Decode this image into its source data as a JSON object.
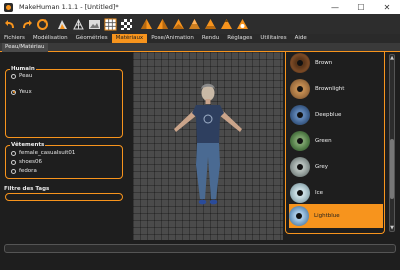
{
  "window": {
    "title": "MakeHuman 1.1.1 - [Untitled]*",
    "minimize": "—",
    "maximize": "☐",
    "close": "✕"
  },
  "toolbar": {
    "icons": [
      "undo-icon",
      "redo-icon",
      "reset-icon",
      "smooth-icon",
      "wireframe-icon",
      "background-icon",
      "grid-icon",
      "front-view-icon",
      "back-view-icon",
      "left-view-icon",
      "right-view-icon",
      "top-view-icon",
      "bottom-view-icon",
      "reset-camera-icon"
    ]
  },
  "tabs": {
    "items": [
      "Fichiers",
      "Modélisation",
      "Géométries",
      "Matériaux",
      "Pose/Animation",
      "Rendu",
      "Réglages",
      "Utilitaires",
      "Aide"
    ],
    "active": "Matériaux"
  },
  "subtabs": {
    "active": "Peau/Matériau"
  },
  "left": {
    "humain": {
      "title": "Humain",
      "options": [
        {
          "label": "Peau",
          "checked": false
        },
        {
          "label": "Yeux",
          "checked": true
        }
      ]
    },
    "vetements": {
      "title": "Vêtements",
      "options": [
        {
          "label": "female_casualsuit01",
          "checked": false
        },
        {
          "label": "shoes06",
          "checked": false
        },
        {
          "label": "fedora",
          "checked": false
        }
      ]
    },
    "filter": {
      "title": "Filtre des Tags",
      "value": ""
    }
  },
  "materials": {
    "items": [
      {
        "label": "Brown",
        "color": "#7a4a26",
        "selected": false
      },
      {
        "label": "Brownlight",
        "color": "#a07040",
        "selected": false
      },
      {
        "label": "Deepblue",
        "color": "#3d5f8c",
        "selected": false
      },
      {
        "label": "Green",
        "color": "#4f7a45",
        "selected": false
      },
      {
        "label": "Grey",
        "color": "#8a9592",
        "selected": false
      },
      {
        "label": "Ice",
        "color": "#9fb8bf",
        "selected": false
      },
      {
        "label": "Lightblue",
        "color": "#6f9ac0",
        "selected": true
      }
    ]
  },
  "status": {
    "progress": 0,
    "message": ""
  }
}
